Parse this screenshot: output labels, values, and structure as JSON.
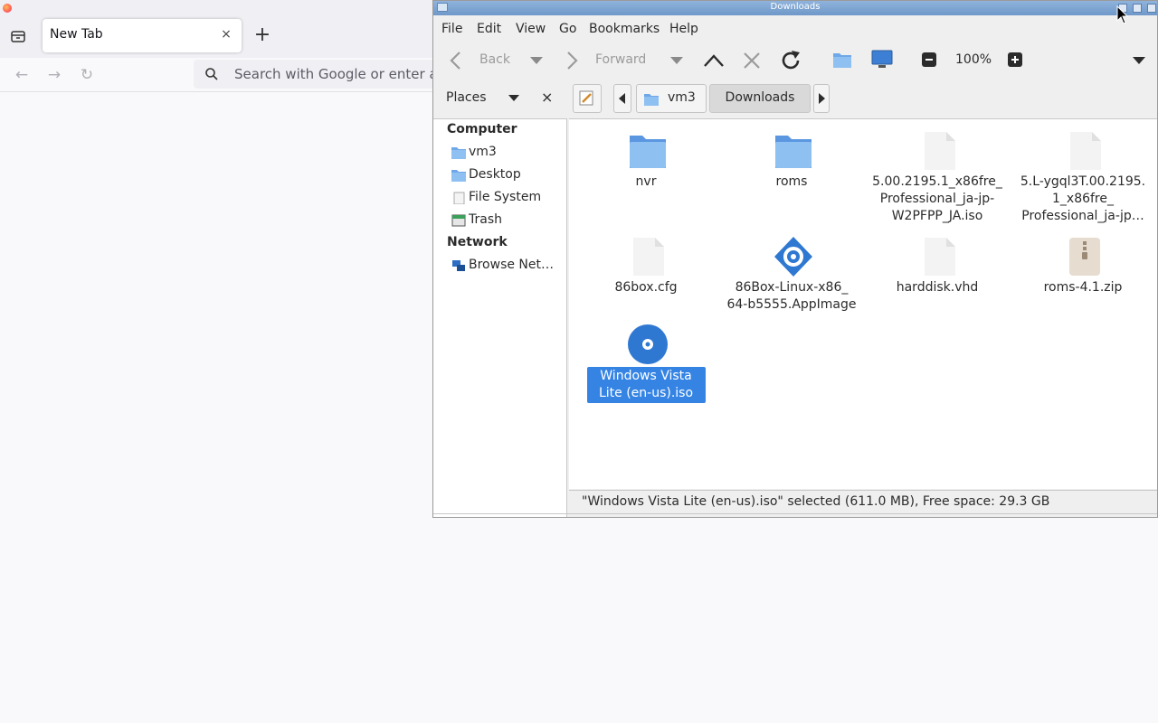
{
  "browser": {
    "tab": {
      "title": "New Tab",
      "close": "×"
    },
    "new_tab": "+",
    "urlbar": {
      "placeholder": "Search with Google or enter address"
    }
  },
  "file_manager": {
    "title": "Downloads",
    "menu": [
      "File",
      "Edit",
      "View",
      "Go",
      "Bookmarks",
      "Help"
    ],
    "toolbar": {
      "back": "Back",
      "forward": "Forward",
      "zoom": "100%"
    },
    "places_label": "Places",
    "places_close": "×",
    "breadcrumb": [
      "vm3",
      "Downloads"
    ],
    "sidebar": {
      "computer_header": "Computer",
      "computer_items": [
        "vm3",
        "Desktop",
        "File System",
        "Trash"
      ],
      "network_header": "Network",
      "network_items": [
        "Browse Netw…"
      ]
    },
    "files": [
      {
        "name": "nvr",
        "type": "folder"
      },
      {
        "name": "roms",
        "type": "folder"
      },
      {
        "name": "5.00.2195.1_x86fre_ Professional_ja-jp- W2PFPP_JA.iso",
        "type": "file"
      },
      {
        "name": "5.L-ygql3T.00.2195. 1_x86fre_ Professional_ja-jp…",
        "type": "file"
      },
      {
        "name": "86box.cfg",
        "type": "file"
      },
      {
        "name": "86Box-Linux-x86_ 64-b5555.AppImage",
        "type": "appimage"
      },
      {
        "name": "harddisk.vhd",
        "type": "file"
      },
      {
        "name": "roms-4.1.zip",
        "type": "zip"
      },
      {
        "name": "Windows Vista Lite (en-us).iso",
        "type": "disc",
        "selected": true
      }
    ],
    "status": "\"Windows Vista Lite (en-us).iso\" selected (611.0 MB), Free space: 29.3 GB"
  },
  "colors": {
    "selection": "#3584e4",
    "folder": "#6fa8e8",
    "titlebar": "#7ea5d2"
  }
}
